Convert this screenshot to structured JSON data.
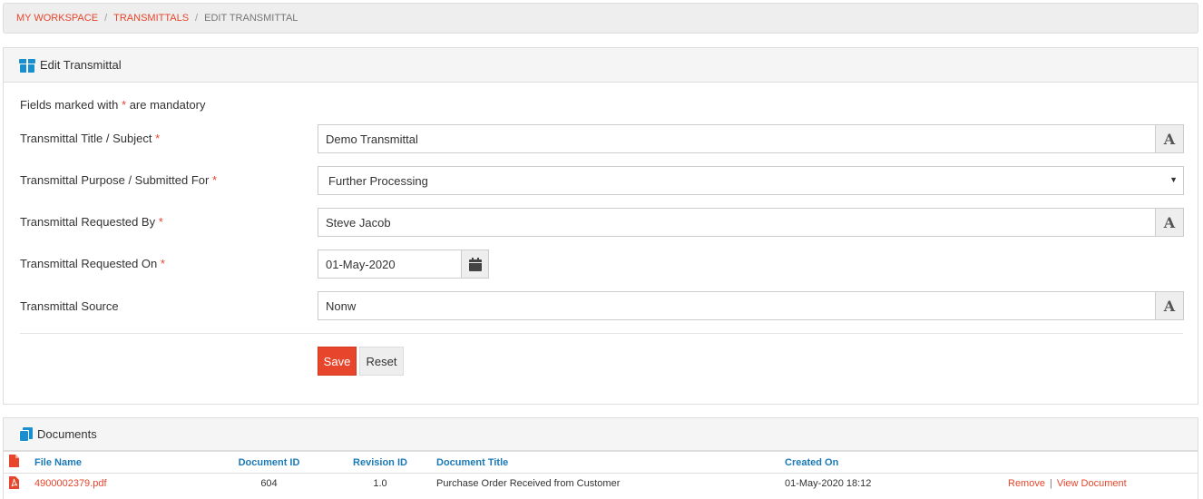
{
  "breadcrumb": {
    "items": [
      "MY WORKSPACE",
      "TRANSMITTALS",
      "EDIT TRANSMITTAL"
    ],
    "separator": "/"
  },
  "edit_panel": {
    "title": "Edit Transmittal",
    "icon": "box-icon",
    "mandatory_note_prefix": "Fields marked with",
    "mandatory_star": "*",
    "mandatory_note_suffix": "are mandatory",
    "fields": {
      "title": {
        "label": "Transmittal Title / Subject",
        "value": "Demo Transmittal",
        "required": "*",
        "addon": "A"
      },
      "purpose": {
        "label": "Transmittal Purpose / Submitted For",
        "value": "Further Processing",
        "required": "*"
      },
      "requested_by": {
        "label": "Transmittal Requested By",
        "value": "Steve Jacob",
        "required": "*",
        "addon": "A"
      },
      "requested_on": {
        "label": "Transmittal Requested On",
        "value": "01-May-2020",
        "required": "*"
      },
      "source": {
        "label": "Transmittal Source",
        "value": "Nonw",
        "addon": "A"
      }
    },
    "buttons": {
      "save": "Save",
      "reset": "Reset"
    }
  },
  "documents_panel": {
    "title": "Documents",
    "icon": "documents-icon",
    "columns": [
      "File Name",
      "Document ID",
      "Revision ID",
      "Document Title",
      "Created On"
    ],
    "rows": [
      {
        "file_name": "4900002379.pdf",
        "document_id": "604",
        "revision_id": "1.0",
        "document_title": "Purchase Order Received from Customer",
        "created_on": "01-May-2020 18:12",
        "action_remove": "Remove",
        "action_view": "View Document",
        "action_separator": "|"
      }
    ]
  },
  "colors": {
    "accent_red": "#e7462c",
    "header_blue": "#1b7ab5",
    "icon_blue": "#1a8fd0"
  }
}
